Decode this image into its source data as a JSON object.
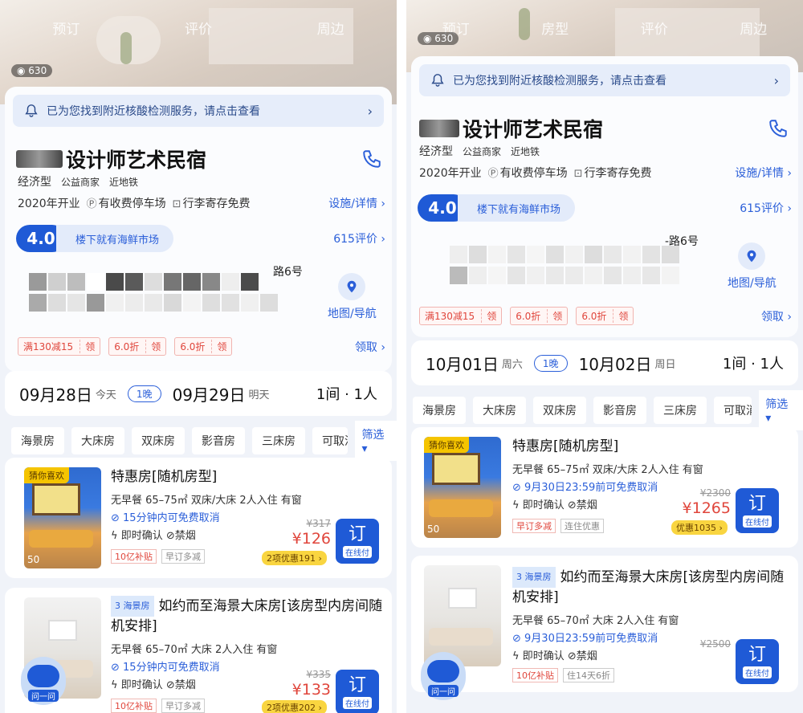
{
  "left": {
    "hero": {
      "tabs": [
        "预订",
        "评价",
        "周边"
      ],
      "photo_count": "630"
    },
    "notice": {
      "text": "已为您找到附近核酸检测服务，请点击查看",
      "chevron": "›"
    },
    "hotel": {
      "title": "设计师艺术民宿",
      "tags": [
        "经济型",
        "公益商家",
        "近地铁"
      ],
      "opened": "2020年开业",
      "parking": "有收费停车场",
      "luggage": "行李寄存免费",
      "facilities_link": "设施/详情 ›",
      "score": "4.0",
      "score_text": "楼下就有海鲜市场",
      "reviews": "615评价 ›",
      "address_suffix": "路6号",
      "map_label": "地图/导航"
    },
    "coupons": [
      {
        "text": "满130减15",
        "action": "领"
      },
      {
        "text": "6.0折",
        "action": "领"
      },
      {
        "text": "6.0折",
        "action": "领"
      }
    ],
    "receive": "领取 ›",
    "dates": {
      "checkin": "09月28日",
      "checkin_day": "今天",
      "nights": "1晚",
      "checkout": "09月29日",
      "checkout_day": "明天",
      "rooms": "1间 · 1人"
    },
    "filters": [
      "海景房",
      "大床房",
      "双床房",
      "影音房",
      "三床房",
      "可取消"
    ],
    "filter_btn": "筛选 ▾",
    "rooms": [
      {
        "badge": "猜你喜欢",
        "img_num": "50",
        "name": "特惠房[随机房型]",
        "line1": "无早餐 65–75㎡ 双床/大床 2人入住 有窗",
        "line2": "15分钟内可免费取消",
        "line3": "即时确认",
        "line3b": "禁烟",
        "tags": [
          "10亿补贴",
          "早订多减"
        ],
        "price_old": "¥317",
        "price_new": "¥126",
        "discount": "2项优惠191 ›",
        "book": "订",
        "book_sub": "在线付"
      },
      {
        "sea_tag": "3 海景房",
        "img_num": "72",
        "name": "如约而至海景大床房[该房型内房间随机安排]",
        "line1": "无早餐 65–70㎡ 大床 2人入住 有窗",
        "line2": "15分钟内可免费取消",
        "line3": "即时确认",
        "line3b": "禁烟",
        "tags": [
          "10亿补贴",
          "早订多减"
        ],
        "price_old": "¥335",
        "price_new": "¥133",
        "discount": "2项优惠202 ›",
        "book": "订",
        "book_sub": "在线付"
      }
    ],
    "bot_label": "问一问"
  },
  "right": {
    "hero": {
      "tabs": [
        "预订",
        "房型",
        "评价",
        "周边"
      ],
      "photo_count": "630"
    },
    "notice": {
      "text": "已为您找到附近核酸检测服务，请点击查看",
      "chevron": "›"
    },
    "hotel": {
      "title": "设计师艺术民宿",
      "tags": [
        "经济型",
        "公益商家",
        "近地铁"
      ],
      "opened": "2020年开业",
      "parking": "有收费停车场",
      "luggage": "行李寄存免费",
      "facilities_link": "设施/详情 ›",
      "score": "4.0",
      "score_text": "楼下就有海鲜市场",
      "reviews": "615评价 ›",
      "address_suffix": "-路6号",
      "map_label": "地图/导航"
    },
    "coupons": [
      {
        "text": "满130减15",
        "action": "领"
      },
      {
        "text": "6.0折",
        "action": "领"
      },
      {
        "text": "6.0折",
        "action": "领"
      }
    ],
    "receive": "领取 ›",
    "dates": {
      "checkin": "10月01日",
      "checkin_day": "周六",
      "nights": "1晚",
      "checkout": "10月02日",
      "checkout_day": "周日",
      "rooms": "1间 · 1人"
    },
    "filters": [
      "海景房",
      "大床房",
      "双床房",
      "影音房",
      "三床房",
      "可取消"
    ],
    "filter_btn": "筛选 ▾",
    "rooms": [
      {
        "badge": "猜你喜欢",
        "img_num": "50",
        "name": "特惠房[随机房型]",
        "line1": "无早餐 65–75㎡ 双床/大床 2人入住 有窗",
        "line2": "9月30日23:59前可免费取消",
        "line3": "即时确认",
        "line3b": "禁烟",
        "tags": [
          "早订多减",
          "连住优惠"
        ],
        "price_old": "¥2300",
        "price_new": "¥1265",
        "discount": "优惠1035 ›",
        "book": "订",
        "book_sub": "在线付"
      },
      {
        "sea_tag": "3 海景房",
        "img_num": "",
        "name": "如约而至海景大床房[该房型内房间随机安排]",
        "line1": "无早餐 65–70㎡ 大床 2人入住 有窗",
        "line2": "9月30日23:59前可免费取消",
        "line3": "即时确认",
        "line3b": "禁烟",
        "tags": [
          "10亿补贴",
          "住14天6折"
        ],
        "price_old": "¥2500",
        "price_new": "",
        "discount": "",
        "book": "订",
        "book_sub": "在线付"
      }
    ],
    "bot_label": "问一问"
  }
}
